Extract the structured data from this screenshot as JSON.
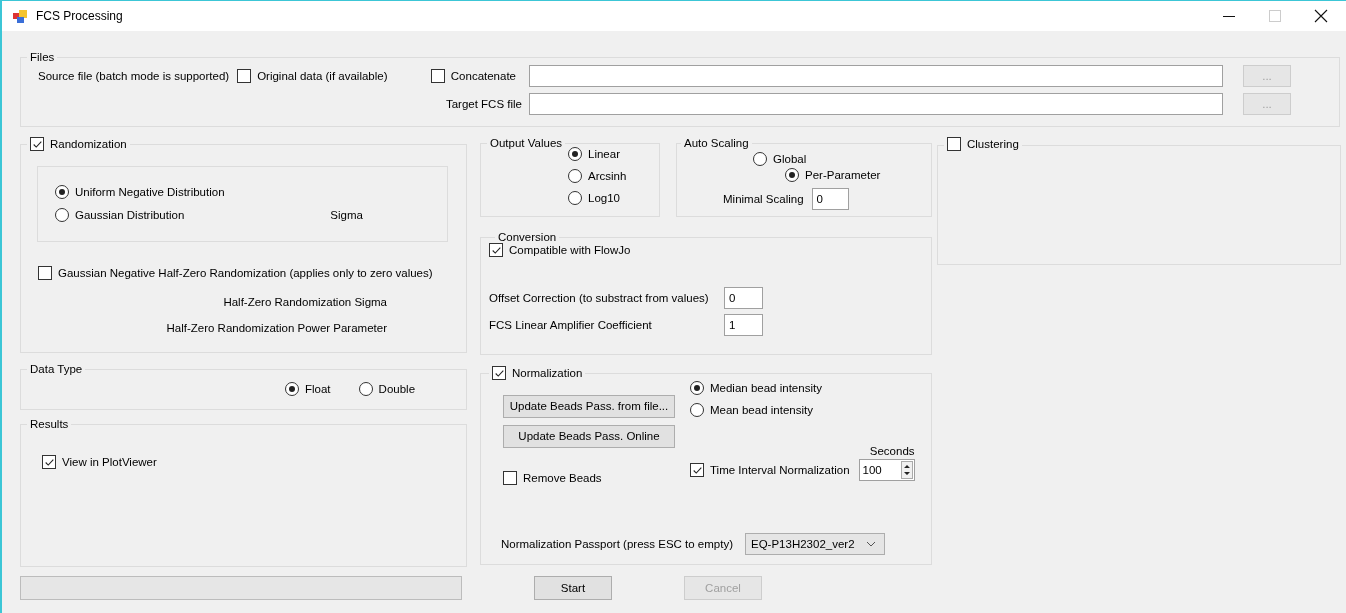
{
  "window": {
    "title": "FCS Processing"
  },
  "files": {
    "title": "Files",
    "source_label": "Source file (batch mode is supported)",
    "original_data": {
      "label": "Original data (if available)",
      "checked": false
    },
    "concatenate": {
      "label": "Concatenate",
      "checked": false
    },
    "target_label": "Target FCS file",
    "browse_buttons": [
      {
        "label": "...",
        "disabled": true
      },
      {
        "label": "...",
        "disabled": true
      }
    ]
  },
  "randomization": {
    "label": "Randomization",
    "checked": true,
    "distributions": [
      {
        "label": "Uniform Negative Distribution",
        "selected": true
      },
      {
        "label": "Gaussian Distribution",
        "selected": false
      }
    ],
    "sigma_label": "Sigma",
    "half_zero": {
      "label": "Gaussian  Negative Half-Zero Randomization (applies only to zero values)",
      "checked": false
    },
    "half_zero_sigma_label": "Half-Zero Randomization Sigma",
    "half_zero_power_label": "Half-Zero Randomization Power Parameter"
  },
  "data_type": {
    "title": "Data Type",
    "options": [
      {
        "label": "Float",
        "selected": true
      },
      {
        "label": "Double",
        "selected": false
      }
    ]
  },
  "results": {
    "title": "Results",
    "view_in_plotviewer": {
      "label": "View in PlotViewer",
      "checked": true
    }
  },
  "progress": {
    "level": 0
  },
  "output_values": {
    "title": "Output Values",
    "options": [
      {
        "label": "Linear",
        "selected": true
      },
      {
        "label": "Arcsinh",
        "selected": false
      },
      {
        "label": "Log10",
        "selected": false
      }
    ]
  },
  "auto_scaling": {
    "title": "Auto Scaling",
    "options": [
      {
        "label": "Global",
        "selected": false
      },
      {
        "label": "Per-Parameter",
        "selected": true
      }
    ],
    "minimal_scaling_label": "Minimal Scaling",
    "minimal_scaling_value": "0"
  },
  "conversion": {
    "title": "Conversion",
    "compatible": {
      "label": "Compatible with FlowJo",
      "checked": true
    },
    "offset_label": "Offset Correction (to substract from values)",
    "offset_value": "0",
    "amplifier_label": "FCS Linear Amplifier Coefficient",
    "amplifier_value": "1"
  },
  "normalization": {
    "label": "Normalization",
    "checked": true,
    "buttons": [
      {
        "label": "Update Beads Pass. from file..."
      },
      {
        "label": "Update Beads Pass. Online"
      }
    ],
    "remove_beads": {
      "label": "Remove Beads",
      "checked": false
    },
    "intensity_options": [
      {
        "label": "Median bead intensity",
        "selected": true
      },
      {
        "label": "Mean bead intensity",
        "selected": false
      }
    ],
    "time_interval": {
      "label": "Time Interval Normalization",
      "checked": true
    },
    "seconds_label": "Seconds",
    "seconds_value": "100",
    "passport_label": "Normalization Passport (press ESC to empty)",
    "passport_value": "EQ-P13H2302_ver2"
  },
  "clustering": {
    "label": "Clustering",
    "checked": false
  },
  "actions": [
    {
      "label": "Start",
      "disabled": false
    },
    {
      "label": "Cancel",
      "disabled": true
    }
  ]
}
